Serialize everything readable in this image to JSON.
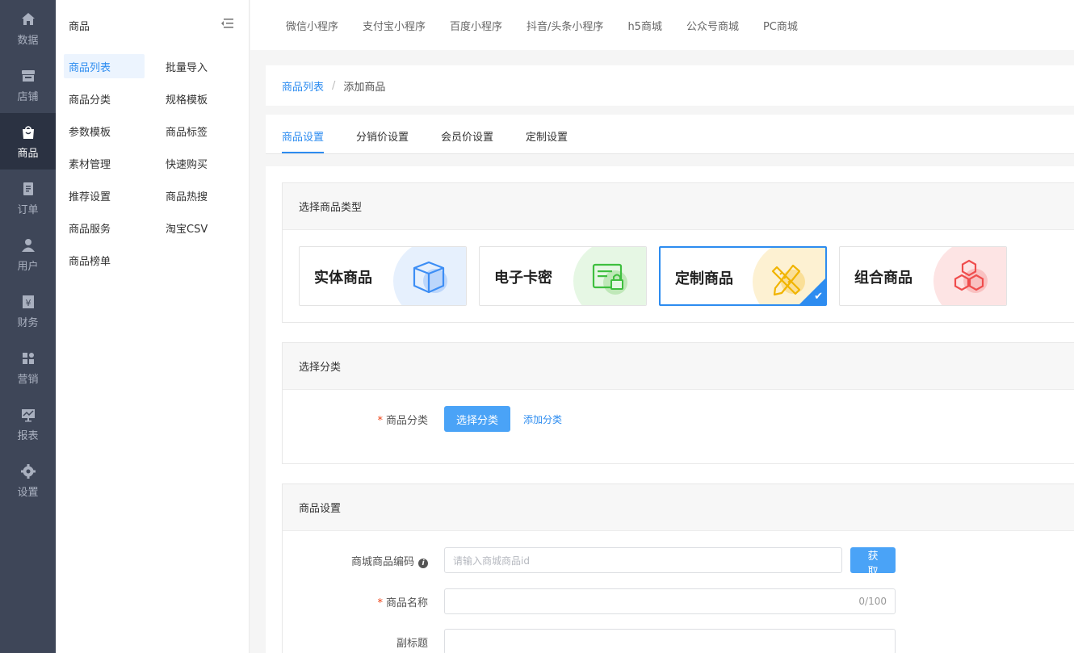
{
  "primary_nav": [
    {
      "label": "数据",
      "icon": "home-icon"
    },
    {
      "label": "店铺",
      "icon": "store-icon"
    },
    {
      "label": "商品",
      "icon": "bag-icon",
      "active": true
    },
    {
      "label": "订单",
      "icon": "document-icon"
    },
    {
      "label": "用户",
      "icon": "user-icon"
    },
    {
      "label": "财务",
      "icon": "yen-icon"
    },
    {
      "label": "营销",
      "icon": "grid-icon"
    },
    {
      "label": "报表",
      "icon": "chart-icon"
    },
    {
      "label": "设置",
      "icon": "gear-icon"
    }
  ],
  "sub_nav": {
    "title": "商品",
    "items": [
      "商品列表",
      "批量导入",
      "商品分类",
      "规格模板",
      "参数模板",
      "商品标签",
      "素材管理",
      "快速购买",
      "推荐设置",
      "商品热搜",
      "商品服务",
      "淘宝CSV",
      "商品榜单"
    ]
  },
  "top_tabs": [
    "微信小程序",
    "支付宝小程序",
    "百度小程序",
    "抖音/头条小程序",
    "h5商城",
    "公众号商城",
    "PC商城"
  ],
  "breadcrumb": {
    "parent": "商品列表",
    "separator": "/",
    "current": "添加商品"
  },
  "content_tabs": [
    "商品设置",
    "分销价设置",
    "会员价设置",
    "定制设置"
  ],
  "type_section": {
    "title": "选择商品类型",
    "types": [
      {
        "name": "实体商品",
        "icon": "box-icon",
        "color": "#3d8ef5",
        "bg": "#e6f0fd"
      },
      {
        "name": "电子卡密",
        "icon": "card-lock-icon",
        "color": "#3fbf3f",
        "bg": "#e6f7e4"
      },
      {
        "name": "定制商品",
        "icon": "pencil-ruler-icon",
        "color": "#f1b400",
        "bg": "#fdf1d2",
        "selected": true
      },
      {
        "name": "组合商品",
        "icon": "hexagons-icon",
        "color": "#ef4d4d",
        "bg": "#fde4e4"
      }
    ]
  },
  "category_section": {
    "title": "选择分类",
    "label": "商品分类",
    "select_button": "选择分类",
    "add_link": "添加分类"
  },
  "settings_section": {
    "title": "商品设置",
    "code_label": "商城商品编码",
    "code_placeholder": "请输入商城商品id",
    "fetch_button": "获取",
    "name_label": "商品名称",
    "name_counter": "0/100",
    "subtitle_label": "副标题"
  }
}
